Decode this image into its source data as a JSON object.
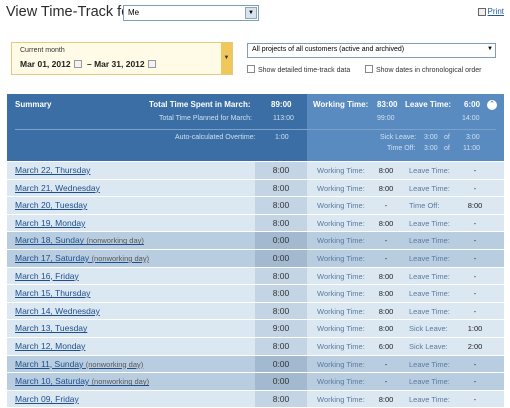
{
  "header": {
    "title": "View Time-Track for:",
    "user": "Me",
    "print_label": "Print"
  },
  "filters": {
    "period_label": "Current month",
    "period_from": "Mar 01, 2012",
    "period_sep": "–",
    "period_to": "Mar 31, 2012",
    "project": "All projects of all customers (active and archived)",
    "show_details": "Show detailed time-track data",
    "show_dates": "Show dates in chronological order"
  },
  "summary": {
    "title": "Summary",
    "total_label": "Total Time Spent in March:",
    "total_value": "89:00",
    "planned_label": "Total Time Planned for March:",
    "planned_value": "113:00",
    "overtime_label": "Auto-calculated Overtime:",
    "overtime_value": "1:00",
    "working_label": "Working Time:",
    "working_value": "83:00",
    "working_planned": "99:00",
    "leave_label": "Leave Time:",
    "leave_value": "6:00",
    "leave_planned": "14:00",
    "sick_label": "Sick Leave:",
    "sick_used": "3:00",
    "sick_of": "of",
    "sick_total": "3:00",
    "timeoff_label": "Time Off:",
    "timeoff_used": "3:00",
    "timeoff_of": "of",
    "timeoff_total": "11:00"
  },
  "rows": [
    {
      "date": "March 22, Thursday",
      "note": "",
      "total": "8:00",
      "wlabel": "Working Time:",
      "wval": "8:00",
      "llabel": "Leave Time:",
      "lval": "-",
      "off": false
    },
    {
      "date": "March 21, Wednesday",
      "note": "",
      "total": "8:00",
      "wlabel": "Working Time:",
      "wval": "8:00",
      "llabel": "Leave Time:",
      "lval": "-",
      "off": false
    },
    {
      "date": "March 20, Tuesday",
      "note": "",
      "total": "8:00",
      "wlabel": "Working Time:",
      "wval": "-",
      "llabel": "Time Off:",
      "lval": "8:00",
      "off": false
    },
    {
      "date": "March 19, Monday",
      "note": "",
      "total": "8:00",
      "wlabel": "Working Time:",
      "wval": "8:00",
      "llabel": "Leave Time:",
      "lval": "-",
      "off": false
    },
    {
      "date": "March 18, Sunday",
      "note": "(nonworking day)",
      "total": "0:00",
      "wlabel": "Working Time:",
      "wval": "-",
      "llabel": "Leave Time:",
      "lval": "-",
      "off": true
    },
    {
      "date": "March 17, Saturday",
      "note": "(nonworking day)",
      "total": "0:00",
      "wlabel": "Working Time:",
      "wval": "-",
      "llabel": "Leave Time:",
      "lval": "-",
      "off": true
    },
    {
      "date": "March 16, Friday",
      "note": "",
      "total": "8:00",
      "wlabel": "Working Time:",
      "wval": "8:00",
      "llabel": "Leave Time:",
      "lval": "-",
      "off": false
    },
    {
      "date": "March 15, Thursday",
      "note": "",
      "total": "8:00",
      "wlabel": "Working Time:",
      "wval": "8:00",
      "llabel": "Leave Time:",
      "lval": "-",
      "off": false
    },
    {
      "date": "March 14, Wednesday",
      "note": "",
      "total": "8:00",
      "wlabel": "Working Time:",
      "wval": "8:00",
      "llabel": "Leave Time:",
      "lval": "-",
      "off": false
    },
    {
      "date": "March 13, Tuesday",
      "note": "",
      "total": "9:00",
      "wlabel": "Working Time:",
      "wval": "8:00",
      "llabel": "Sick Leave:",
      "lval": "1:00",
      "off": false
    },
    {
      "date": "March 12, Monday",
      "note": "",
      "total": "8:00",
      "wlabel": "Working Time:",
      "wval": "6:00",
      "llabel": "Sick Leave:",
      "lval": "2:00",
      "off": false
    },
    {
      "date": "March 11, Sunday",
      "note": "(nonworking day)",
      "total": "0:00",
      "wlabel": "Working Time:",
      "wval": "-",
      "llabel": "Leave Time:",
      "lval": "-",
      "off": true
    },
    {
      "date": "March 10, Saturday",
      "note": "(nonworking day)",
      "total": "0:00",
      "wlabel": "Working Time:",
      "wval": "-",
      "llabel": "Leave Time:",
      "lval": "-",
      "off": true
    },
    {
      "date": "March 09, Friday",
      "note": "",
      "total": "8:00",
      "wlabel": "Working Time:",
      "wval": "8:00",
      "llabel": "Leave Time:",
      "lval": "-",
      "off": false
    }
  ]
}
